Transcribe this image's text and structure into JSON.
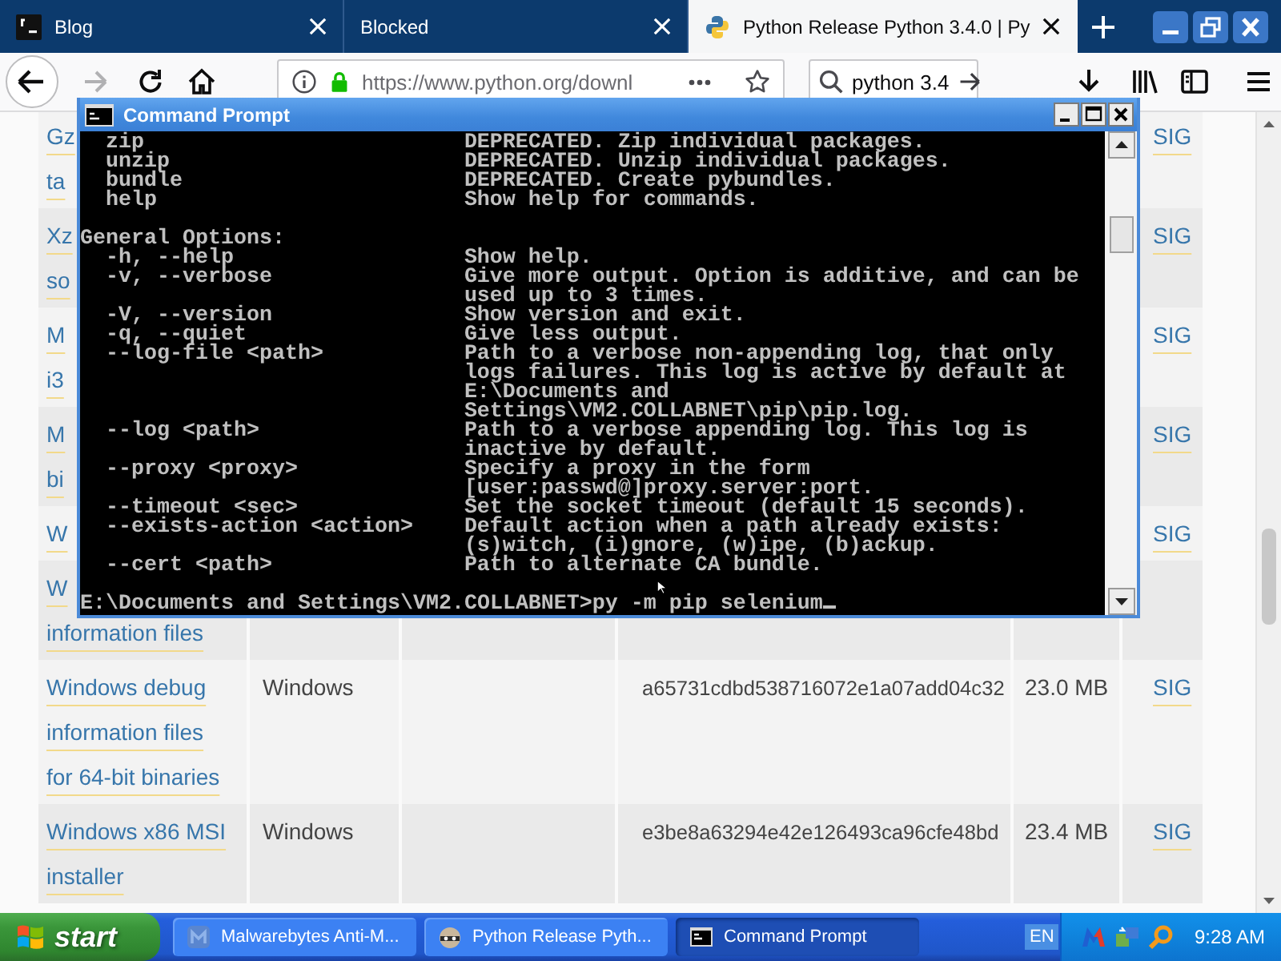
{
  "browser": {
    "tabs": [
      {
        "title": "Blog",
        "selected": false
      },
      {
        "title": "Blocked",
        "selected": false
      },
      {
        "title": "Python Release Python 3.4.0 | Py",
        "selected": true
      }
    ],
    "navigation": {
      "forward_disabled": true,
      "url": "https://www.python.org/downl",
      "search_value": "python 3.4"
    },
    "page": {
      "rows": [
        {
          "kind": "partial",
          "column_1_lines": [
            "Gz",
            "ta"
          ],
          "column_6": "SIG"
        },
        {
          "kind": "partial",
          "column_1_lines": [
            "Xz",
            "so"
          ],
          "column_6": "SIG"
        },
        {
          "kind": "partial",
          "column_1_lines": [
            "M",
            "i3"
          ],
          "column_6": "SIG"
        },
        {
          "kind": "partial",
          "column_1_lines": [
            "M",
            "bi"
          ],
          "column_6": "SIG"
        },
        {
          "kind": "partial",
          "column_1_lines": [
            "W"
          ],
          "column_6": "SIG"
        },
        {
          "kind": "partial",
          "column_1_lines": [
            "W",
            "information files"
          ]
        },
        {
          "kind": "full",
          "column_1": "Windows debug information files for 64-bit binaries",
          "column_2": "Windows",
          "column_4": "a65731cdbd538716072e1a07add04c32",
          "column_5": "23.0 MB",
          "column_6": "SIG"
        },
        {
          "kind": "full",
          "column_1": "Windows x86 MSI installer",
          "column_2": "Windows",
          "column_4": "e3be8a63294e42e126493ca96cfe48bd",
          "column_5": "23.4 MB",
          "column_6": "SIG"
        }
      ]
    }
  },
  "command_prompt": {
    "title": "Command Prompt",
    "sections": [
      {
        "entries": [
          {
            "option": "zip",
            "description": "DEPRECATED. Zip individual packages."
          },
          {
            "option": "unzip",
            "description": "DEPRECATED. Unzip individual packages."
          },
          {
            "option": "bundle",
            "description": "DEPRECATED. Create pybundles."
          },
          {
            "option": "help",
            "description": "Show help for commands."
          }
        ]
      },
      {
        "heading": "General Options:",
        "entries": [
          {
            "option": "-h, --help",
            "description": "Show help."
          },
          {
            "option": "-v, --verbose",
            "description": "Give more output. Option is additive, and can be used up to 3 times."
          },
          {
            "option": "-V, --version",
            "description": "Show version and exit."
          },
          {
            "option": "-q, --quiet",
            "description": "Give less output."
          },
          {
            "option": "--log-file <path>",
            "description": "Path to a verbose non-appending log, that only logs failures. This log is active by default at E:\\Documents and Settings\\VM2.COLLABNET\\pip\\pip.log."
          },
          {
            "option": "--log <path>",
            "description": "Path to a verbose appending log. This log is inactive by default."
          },
          {
            "option": "--proxy <proxy>",
            "description": "Specify a proxy in the form [user:passwd@]proxy.server:port."
          },
          {
            "option": "--timeout <sec>",
            "description": "Set the socket timeout (default 15 seconds)."
          },
          {
            "option": "--exists-action <action>",
            "description": "Default action when a path already exists: (s)witch, (i)gnore, (w)ipe, (b)ackup."
          },
          {
            "option": "--cert <path>",
            "description": "Path to alternate CA bundle."
          }
        ]
      }
    ],
    "prompt_line": "E:\\Documents and Settings\\VM2.COLLABNET>py -m pip selenium"
  },
  "taskbar": {
    "start_button": "start",
    "tasks": [
      {
        "label": "Malwarebytes Anti-M...",
        "selected": false
      },
      {
        "label": "Python Release Pyth...",
        "selected": false
      },
      {
        "label": "Command Prompt",
        "selected": true
      }
    ],
    "language": "EN",
    "clock": "9:28 AM"
  }
}
